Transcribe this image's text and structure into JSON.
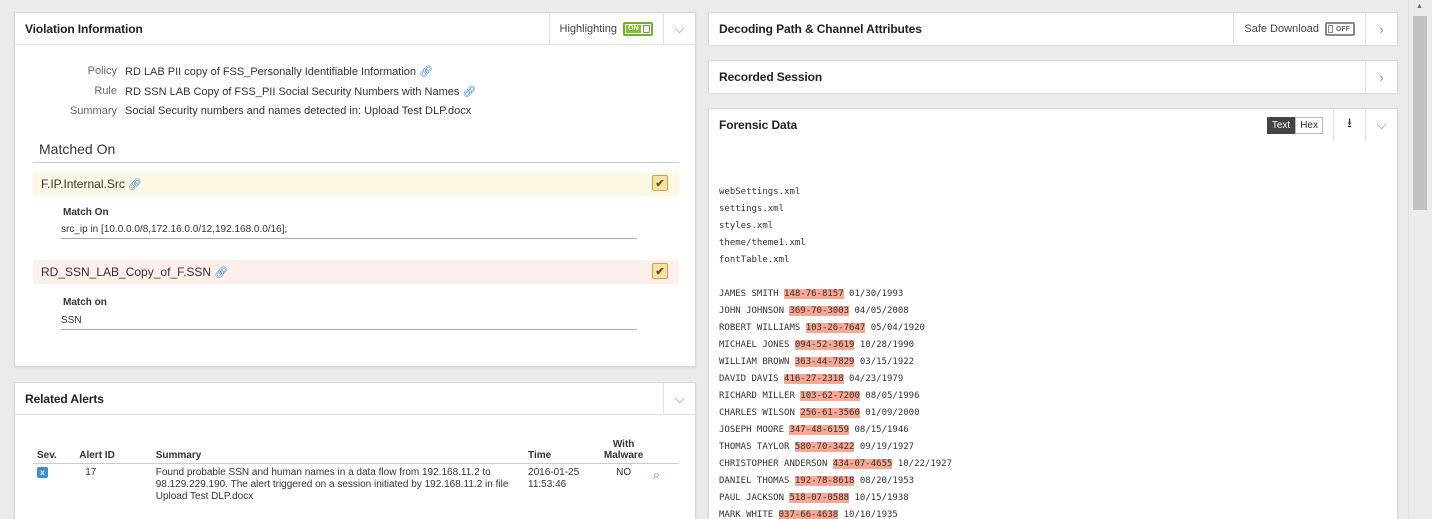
{
  "violation": {
    "title": "Violation Information",
    "highlighting_label": "Highlighting",
    "highlighting_state": "ON",
    "policy_label": "Policy",
    "policy_value": "RD LAB PII copy of FSS_Personally Identifiable Information",
    "rule_label": "Rule",
    "rule_value": "RD SSN LAB Copy of FSS_PII Social Security Numbers with Names",
    "summary_label": "Summary",
    "summary_value": "Social Security numbers and names detected in: Upload Test DLP.docx",
    "matched_on_title": "Matched On",
    "matches": [
      {
        "name": "F.IP.Internal.Src",
        "sub_label": "Match On",
        "sub_value": "src_ip in [10.0.0.0/8,172.16.0.0/12,192.168.0.0/16];"
      },
      {
        "name": "RD_SSN_LAB_Copy_of_F.SSN",
        "sub_label": "Match on",
        "sub_value": "SSN"
      }
    ]
  },
  "related": {
    "title": "Related Alerts",
    "headers": {
      "sev": "Sev.",
      "alert_id": "Alert ID",
      "summary": "Summary",
      "time": "Time",
      "malware": "With Malware"
    },
    "rows": [
      {
        "sev": "x",
        "alert_id": "17",
        "summary": "Found probable SSN and human names in a data flow from 192.168.11.2 to 98.129.229.190. The alert triggered on a session initiated by 192.168.11.2 in file Upload Test DLP.docx",
        "time": "2016-01-25 11:53:46",
        "malware": "NO"
      }
    ]
  },
  "decoding": {
    "title": "Decoding Path & Channel Attributes",
    "safe_download_label": "Safe Download",
    "safe_download_state": "OFF"
  },
  "recorded": {
    "title": "Recorded Session"
  },
  "forensic": {
    "title": "Forensic Data",
    "text_btn": "Text",
    "hex_btn": "Hex",
    "files": [
      "webSettings.xml",
      "settings.xml",
      "styles.xml",
      "theme/theme1.xml",
      "fontTable.xml"
    ],
    "records": [
      {
        "name": "JAMES SMITH",
        "ssn": "148-76-8157",
        "date": "01/30/1993"
      },
      {
        "name": "JOHN JOHNSON",
        "ssn": "369-70-3003",
        "date": "04/05/2008"
      },
      {
        "name": "ROBERT WILLIAMS",
        "ssn": "103-26-7647",
        "date": "05/04/1920"
      },
      {
        "name": "MICHAEL JONES",
        "ssn": "094-52-3619",
        "date": "10/28/1990"
      },
      {
        "name": "WILLIAM BROWN",
        "ssn": "363-44-7829",
        "date": "03/15/1922"
      },
      {
        "name": "DAVID DAVIS",
        "ssn": "416-27-2318",
        "date": "04/23/1979"
      },
      {
        "name": "RICHARD MILLER",
        "ssn": "103-62-7200",
        "date": "08/05/1996"
      },
      {
        "name": "CHARLES WILSON",
        "ssn": "256-61-3560",
        "date": "01/09/2000"
      },
      {
        "name": "JOSEPH MOORE",
        "ssn": "347-48-6159",
        "date": "08/15/1946"
      },
      {
        "name": "THOMAS TAYLOR",
        "ssn": "580-70-3422",
        "date": "09/19/1927"
      },
      {
        "name": "CHRISTOPHER ANDERSON",
        "ssn": "434-07-4655",
        "date": "10/22/1927"
      },
      {
        "name": "DANIEL THOMAS",
        "ssn": "192-78-8618",
        "date": "08/20/1953"
      },
      {
        "name": "PAUL JACKSON",
        "ssn": "518-07-0588",
        "date": "10/15/1938"
      },
      {
        "name": "MARK WHITE",
        "ssn": "037-66-4638",
        "date": "10/10/1935"
      }
    ]
  },
  "colors": {
    "highlight": "#f7a792",
    "match1_bg": "#fdf8e4",
    "match2_bg": "#fdf0ea",
    "check_bg": "#f5e3a8",
    "toggle_on": "#7bc72c",
    "link": "#2a78c4"
  }
}
